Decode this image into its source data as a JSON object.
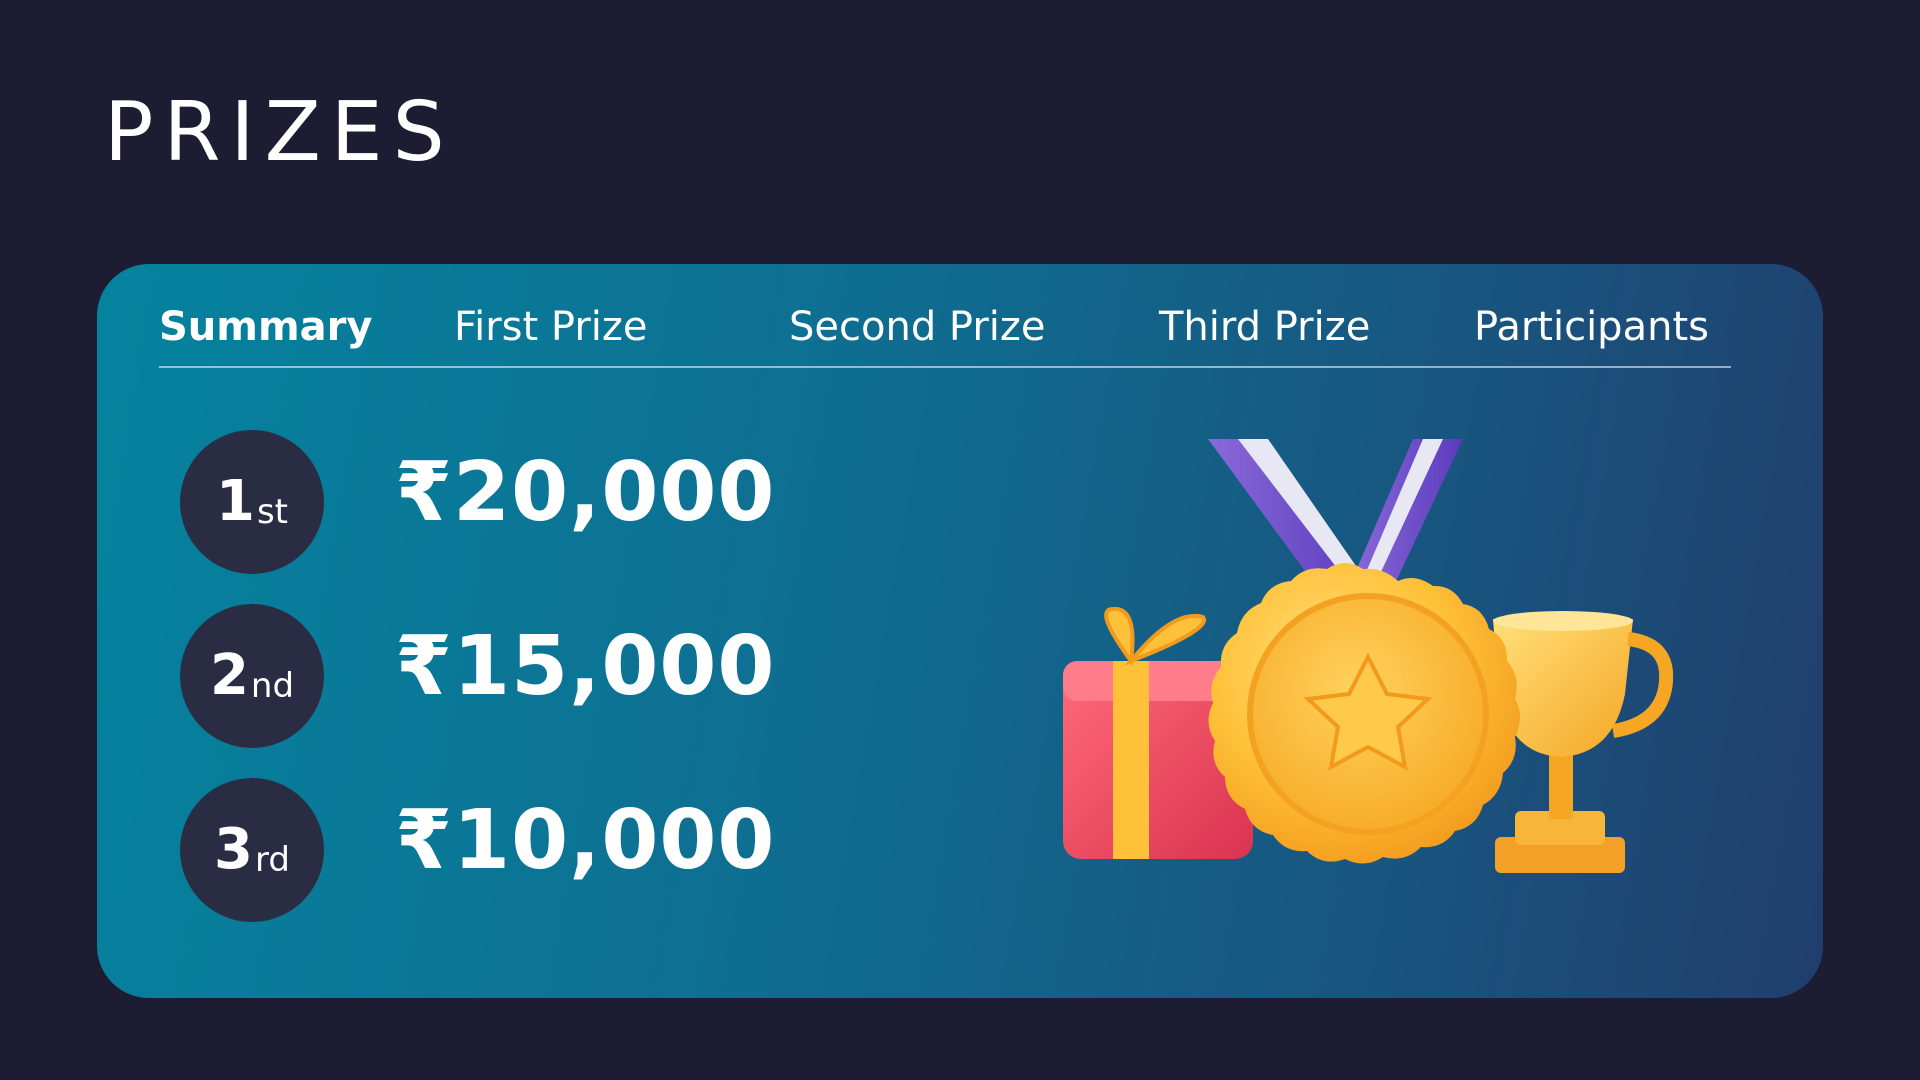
{
  "page": {
    "title": "PRIZES"
  },
  "tabs": [
    {
      "label": "Summary",
      "active": true
    },
    {
      "label": "First Prize",
      "active": false
    },
    {
      "label": "Second Prize",
      "active": false
    },
    {
      "label": "Third Prize",
      "active": false
    },
    {
      "label": "Participants",
      "active": false
    }
  ],
  "prizes": [
    {
      "rank": "1",
      "suffix": "st",
      "amount": "₹20,000"
    },
    {
      "rank": "2",
      "suffix": "nd",
      "amount": "₹15,000"
    },
    {
      "rank": "3",
      "suffix": "rd",
      "amount": "₹10,000"
    }
  ],
  "illustration": {
    "icons": [
      "gift-box-icon",
      "medal-icon",
      "trophy-icon"
    ]
  },
  "colors": {
    "background": "#1c1d33",
    "card_gradient_start": "#05839e",
    "card_gradient_end": "#213e6d",
    "badge": "#2a2c43",
    "gold": "#ffc13a",
    "ribbon_purple": "#6a45c8",
    "gift_red": "#f0485e"
  }
}
